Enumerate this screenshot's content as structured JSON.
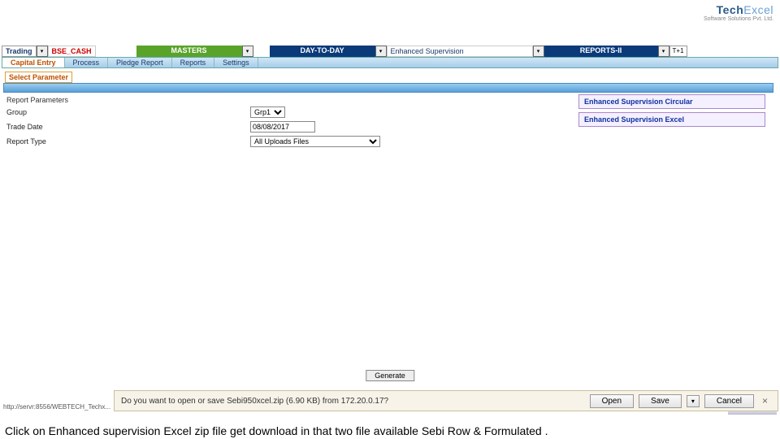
{
  "branding": {
    "logo_a": "Tech",
    "logo_b": "Excel",
    "tagline": "Software Solutions Pvt. Ltd."
  },
  "topbar": {
    "trading": "Trading",
    "bse": "BSE_CASH",
    "masters": "MASTERS",
    "daytoday": "DAY-TO-DAY",
    "enhanced": "Enhanced Supervision",
    "reports2": "REPORTS-II",
    "t1": "T+1"
  },
  "tabs": [
    "Capital Entry",
    "Process",
    "Pledge Report",
    "Reports",
    "Settings"
  ],
  "select_param": "Select Parameter",
  "form": {
    "legend": "Report Parameters",
    "group_label": "Group",
    "group_value": "Grp1",
    "date_label": "Trade Date",
    "date_value": "08/08/2017",
    "type_label": "Report Type",
    "type_value": "All Uploads Files"
  },
  "sidelinks": {
    "circular": "Enhanced Supervision Circular",
    "excel": "Enhanced Supervision Excel"
  },
  "generate": "Generate",
  "download": {
    "prompt": "Do you want to open or save Sebi950xcel.zip (6.90 KB) from 172.20.0.17?",
    "open": "Open",
    "save": "Save",
    "cancel": "Cancel"
  },
  "status_text": "http://servr:8556/WEBTECH_Techx...",
  "caption": "Click on Enhanced supervision Excel zip file get download in that two file available Sebi Row  & Formulated ."
}
